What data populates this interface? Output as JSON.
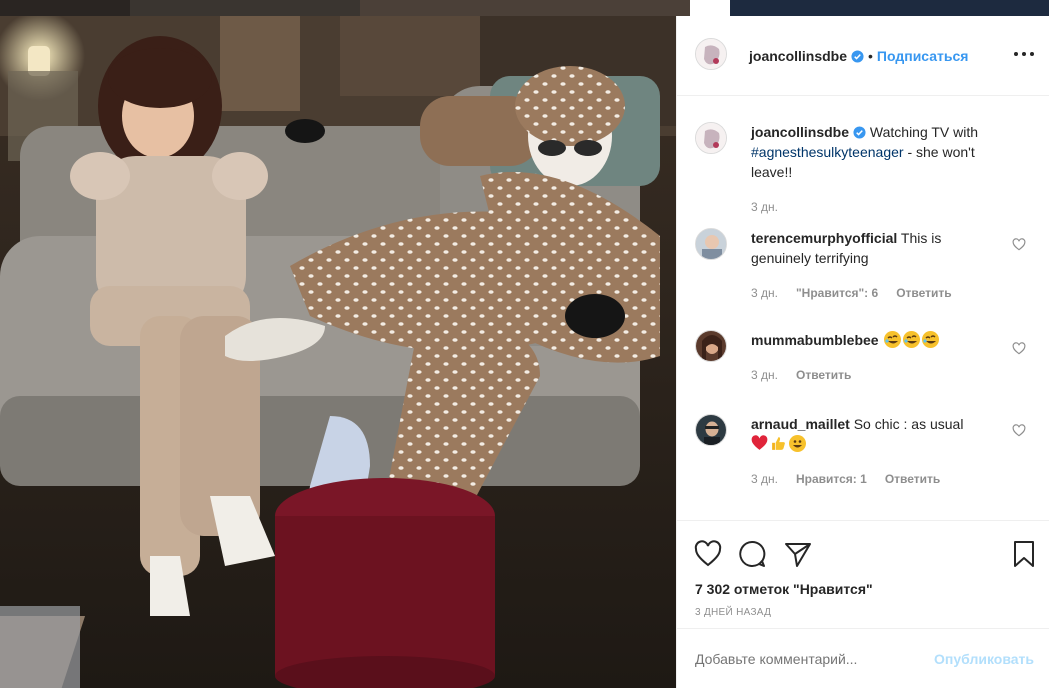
{
  "post": {
    "username": "joancollinsdbe",
    "follow_label": "Подписаться",
    "separator": "•",
    "caption": {
      "username": "joancollinsdbe",
      "text_before": "Watching TV with",
      "hashtag": "#agnesthesulkyteenager",
      "text_after": "- she won't leave!!",
      "time": "3 дн."
    },
    "comments": [
      {
        "username": "terencemurphyofficial",
        "text": "This is genuinely terrifying",
        "time": "3 дн.",
        "likes_label": "\"Нравится\": 6",
        "reply_label": "Ответить",
        "avatar_color": "#b9c6d2"
      },
      {
        "username": "mummabumblebee",
        "text": "",
        "emojis": [
          "rofl-emoji",
          "rofl-emoji",
          "rofl-emoji"
        ],
        "time": "3 дн.",
        "likes_label": "",
        "reply_label": "Ответить",
        "avatar_color": "#6b4a3b"
      },
      {
        "username": "arnaud_maillet",
        "text": "So chic : as usual",
        "emojis": [
          "red-heart-emoji",
          "thumbs-up-emoji",
          "smile-emoji"
        ],
        "time": "3 дн.",
        "likes_label": "Нравится: 1",
        "reply_label": "Ответить",
        "avatar_color": "#3f4a52"
      }
    ],
    "likes_count_label": "7 302 отметок \"Нравится\"",
    "date_label": "3 ДНЕЙ НАЗАД",
    "add_comment_placeholder": "Добавьте комментарий...",
    "publish_label": "Опубликовать",
    "icons": [
      "heart-icon",
      "comment-icon",
      "share-icon",
      "bookmark-icon",
      "more-options-icon",
      "verified-badge-icon"
    ],
    "colors": {
      "link": "#3897f0",
      "hashtag": "#003569",
      "muted": "#8e8e8e",
      "publish_disabled": "#b2dffc"
    }
  }
}
